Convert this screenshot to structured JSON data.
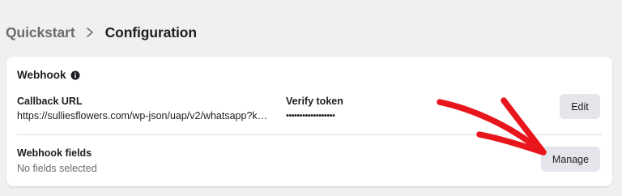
{
  "breadcrumb": {
    "parent": "Quickstart",
    "current": "Configuration"
  },
  "card": {
    "title": "Webhook",
    "callback": {
      "label": "Callback URL",
      "value": "https://sulliesflowers.com/wp-json/uap/v2/whatsapp?k…"
    },
    "verify": {
      "label": "Verify token",
      "value": "••••••••••••••••••"
    },
    "edit_label": "Edit",
    "fields": {
      "label": "Webhook fields",
      "value": "No fields selected"
    },
    "manage_label": "Manage"
  },
  "colors": {
    "page_bg": "#f0f0f0",
    "button_bg": "#e4e6eb",
    "annotation_arrow": "#e8161c"
  }
}
